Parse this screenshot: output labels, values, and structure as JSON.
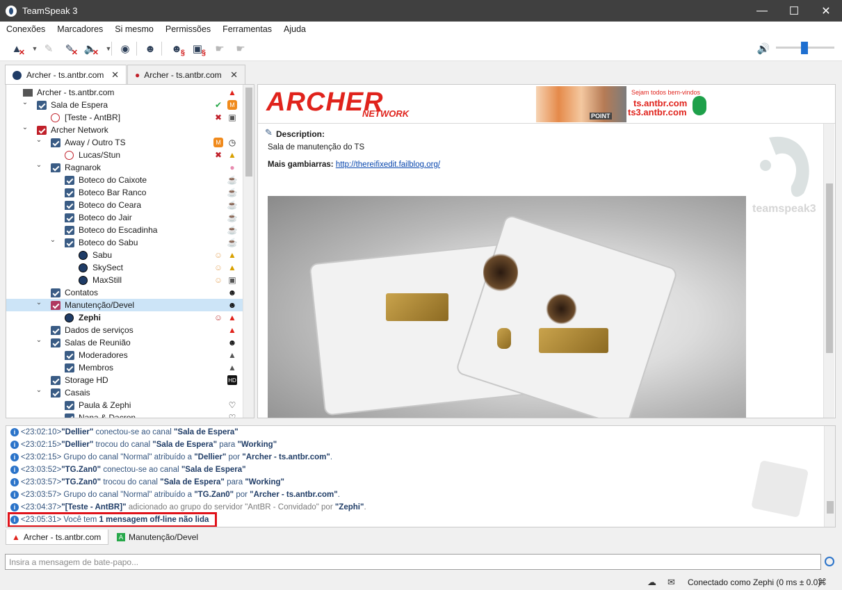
{
  "window": {
    "title": "TeamSpeak 3"
  },
  "menu": [
    "Conexões",
    "Marcadores",
    "Si mesmo",
    "Permissões",
    "Ferramentas",
    "Ajuda"
  ],
  "tabs": [
    {
      "label": "Archer - ts.antbr.com",
      "active": true
    },
    {
      "label": "Archer - ts.antbr.com",
      "active": false
    }
  ],
  "tree": [
    {
      "label": "Archer - ts.antbr.com",
      "kind": "server"
    },
    {
      "label": "Sala de Espera",
      "kind": "channel"
    },
    {
      "label": "[Teste - AntBR]",
      "kind": "user-muted"
    },
    {
      "label": "Archer Network",
      "kind": "channel-red"
    },
    {
      "label": "Away / Outro TS",
      "kind": "channel"
    },
    {
      "label": "Lucas/Stun",
      "kind": "user-muted"
    },
    {
      "label": "Ragnarok",
      "kind": "channel"
    },
    {
      "label": "Boteco do Caixote",
      "kind": "channel"
    },
    {
      "label": "Boteco Bar Ranco",
      "kind": "channel"
    },
    {
      "label": "Boteco do Ceara",
      "kind": "channel"
    },
    {
      "label": "Boteco do Jair",
      "kind": "channel"
    },
    {
      "label": "Boteco do Escadinha",
      "kind": "channel"
    },
    {
      "label": "Boteco do Sabu",
      "kind": "channel"
    },
    {
      "label": "Sabu",
      "kind": "user"
    },
    {
      "label": "SkySect",
      "kind": "user"
    },
    {
      "label": "MaxStill",
      "kind": "user"
    },
    {
      "label": "Contatos",
      "kind": "channel"
    },
    {
      "label": "Manutenção/Devel",
      "kind": "channel-selected"
    },
    {
      "label": "Zephi",
      "kind": "user-self"
    },
    {
      "label": "Dados de serviços",
      "kind": "channel"
    },
    {
      "label": "Salas de Reunião",
      "kind": "channel"
    },
    {
      "label": "Moderadores",
      "kind": "channel"
    },
    {
      "label": "Membros",
      "kind": "channel"
    },
    {
      "label": "Storage HD",
      "kind": "channel"
    },
    {
      "label": "Casais",
      "kind": "channel"
    },
    {
      "label": "Paula & Zephi",
      "kind": "channel"
    },
    {
      "label": "Nana & Dacron",
      "kind": "channel"
    }
  ],
  "banner": {
    "logo": "ARCHER",
    "logo_sub": "NETWORK",
    "welcome": "Sejam todos bem-vindos",
    "host1": "ts.antbr.com",
    "host2": "ts3.antbr.com",
    "point": "POINT"
  },
  "description": {
    "heading": "Description:",
    "text": "Sala de manutenção do TS",
    "more_label": "Mais gambiarras:",
    "link": "http://thereifixedit.failblog.org/",
    "watermark": "teamspeak3"
  },
  "log": [
    {
      "time": "<23:02:10>",
      "parts": [
        [
          "n",
          "\"Dellier\""
        ],
        [
          "t",
          " conectou-se ao canal "
        ],
        [
          "n",
          "\"Sala de Espera\""
        ]
      ]
    },
    {
      "time": "<23:02:15>",
      "parts": [
        [
          "n",
          "\"Dellier\""
        ],
        [
          "t",
          " trocou do canal "
        ],
        [
          "n",
          "\"Sala de Espera\""
        ],
        [
          "t",
          " para "
        ],
        [
          "n",
          "\"Working\""
        ]
      ]
    },
    {
      "time": "<23:02:15>",
      "parts": [
        [
          "t",
          " Grupo do canal \"Normal\" atribuído a "
        ],
        [
          "n",
          "\"Dellier\""
        ],
        [
          "t",
          " por "
        ],
        [
          "n",
          "\"Archer - ts.antbr.com\""
        ],
        [
          "t",
          "."
        ]
      ]
    },
    {
      "time": "<23:03:52>",
      "parts": [
        [
          "n",
          "\"TG.Zan0\""
        ],
        [
          "t",
          " conectou-se ao canal "
        ],
        [
          "n",
          "\"Sala de Espera\""
        ]
      ]
    },
    {
      "time": "<23:03:57>",
      "parts": [
        [
          "n",
          "\"TG.Zan0\""
        ],
        [
          "t",
          " trocou do canal "
        ],
        [
          "n",
          "\"Sala de Espera\""
        ],
        [
          "t",
          " para "
        ],
        [
          "n",
          "\"Working\""
        ]
      ]
    },
    {
      "time": "<23:03:57>",
      "parts": [
        [
          "t",
          " Grupo do canal \"Normal\" atribuído a "
        ],
        [
          "n",
          "\"TG.Zan0\""
        ],
        [
          "t",
          " por "
        ],
        [
          "n",
          "\"Archer - ts.antbr.com\""
        ],
        [
          "t",
          "."
        ]
      ]
    },
    {
      "time": "<23:04:37>",
      "parts": [
        [
          "n",
          "\"[Teste - AntBR]\""
        ],
        [
          "m",
          " adicionado ao grupo do servidor \"AntBR - Convidado\" por "
        ],
        [
          "n",
          "\"Zephi\""
        ],
        [
          "m",
          "."
        ]
      ]
    },
    {
      "time": "<23:05:31>",
      "parts": [
        [
          "t",
          " Você tem "
        ],
        [
          "n",
          "1 mensagem off-line não lida"
        ]
      ]
    }
  ],
  "chat_tabs": [
    {
      "label": "Archer - ts.antbr.com",
      "active": true
    },
    {
      "label": "Manutenção/Devel",
      "active": false
    }
  ],
  "chat_input": {
    "placeholder": "Insira a mensagem de bate-papo..."
  },
  "status": {
    "text": "Conectado como Zephi (0 ms ± 0.0)"
  },
  "colors": {
    "accent": "#e0231c",
    "channel": "#3a5c85",
    "selection": "#cce4f7",
    "highlight": "#e0131b"
  }
}
